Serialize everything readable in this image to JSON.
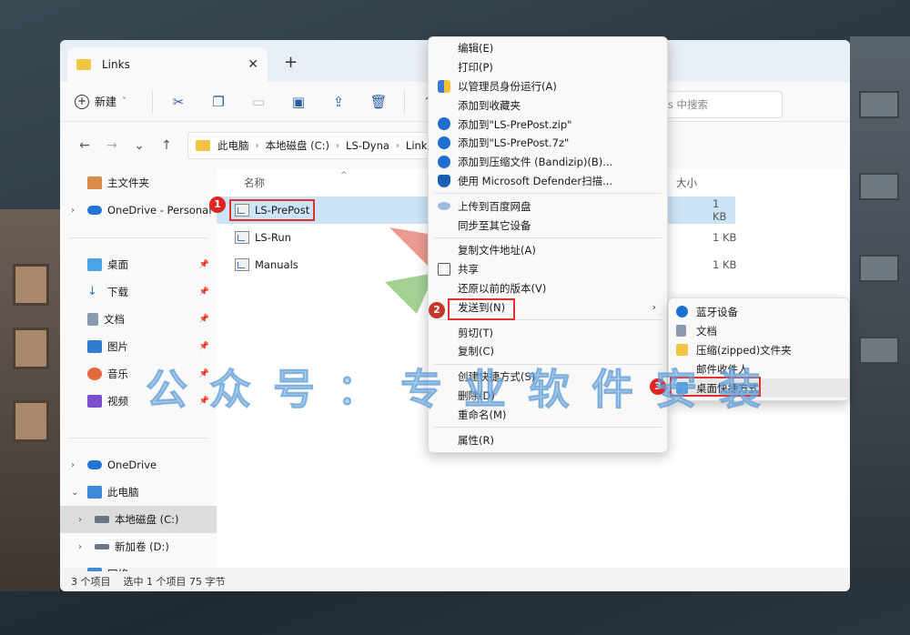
{
  "window": {
    "tab_title": "Links",
    "new_tab_label": "+"
  },
  "toolbar": {
    "new_label": "新建",
    "new_caret": "˅"
  },
  "address": {
    "crumbs": [
      "此电脑",
      "本地磁盘 (C:)",
      "LS-Dyna",
      "Links"
    ],
    "search_placeholder": "在 Links 中搜索"
  },
  "sidebar": {
    "home": "主文件夹",
    "onedrive_personal": "OneDrive - Personal",
    "quick": [
      "桌面",
      "下载",
      "文档",
      "图片",
      "音乐",
      "视频"
    ],
    "onedrive": "OneDrive",
    "this_pc": "此电脑",
    "drive_c": "本地磁盘 (C:)",
    "drive_d": "新加卷 (D:)",
    "network": "网络"
  },
  "filelist": {
    "col_name": "名称",
    "col_size": "大小",
    "files": [
      {
        "name": "LS-PrePost",
        "size": "1 KB"
      },
      {
        "name": "LS-Run",
        "size": "1 KB"
      },
      {
        "name": "Manuals",
        "size": "1 KB"
      }
    ]
  },
  "status": {
    "count": "3 个项目",
    "selected": "选中 1 个项目 75 字节"
  },
  "context_menu": {
    "items": [
      "编辑(E)",
      "打印(P)",
      "以管理员身份运行(A)",
      "添加到收藏夹",
      "添加到\"LS-PrePost.zip\"",
      "添加到\"LS-PrePost.7z\"",
      "添加到压缩文件 (Bandizip)(B)...",
      "使用 Microsoft Defender扫描...",
      "上传到百度网盘",
      "同步至其它设备",
      "复制文件地址(A)",
      "共享",
      "还原以前的版本(V)",
      "发送到(N)",
      "剪切(T)",
      "复制(C)",
      "创建快捷方式(S)",
      "删除(D)",
      "重命名(M)",
      "属性(R)"
    ]
  },
  "submenu": {
    "items": [
      "蓝牙设备",
      "文档",
      "压缩(zipped)文件夹",
      "邮件收件人",
      "桌面快捷方式"
    ]
  },
  "badges": [
    "1",
    "2",
    "3"
  ],
  "watermark": "公众号：专业软件安装",
  "colors": {
    "accent_red": "#e03030",
    "selection_blue": "#cce4f7",
    "folder_yellow": "#f4c342"
  }
}
